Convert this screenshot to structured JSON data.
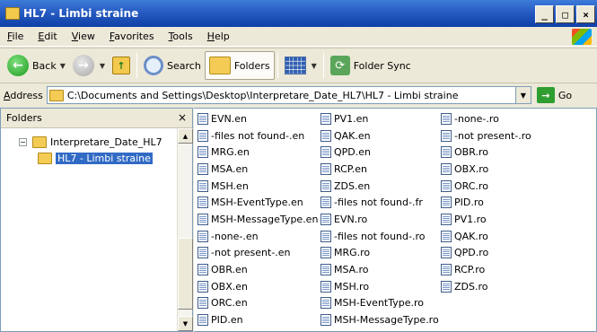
{
  "window": {
    "title": "HL7 - Limbi straine",
    "controls": [
      "_",
      "□",
      "×"
    ]
  },
  "menu": [
    "File",
    "Edit",
    "View",
    "Favorites",
    "Tools",
    "Help"
  ],
  "toolbar": {
    "back_label": "Back",
    "search_label": "Search",
    "folders_label": "Folders",
    "folder_sync_label": "Folder Sync"
  },
  "address": {
    "label": "Address",
    "value": "C:\\Documents and Settings\\Desktop\\Interpretare_Date_HL7\\HL7 - Limbi straine",
    "go_label": "Go"
  },
  "folders_pane": {
    "title": "Folders",
    "close": "×",
    "tree": [
      {
        "label": "Interpretare_Date_HL7",
        "expander": "−"
      },
      {
        "label": "HL7 - Limbi straine"
      }
    ]
  },
  "files": {
    "col1": [
      "EVN.en",
      "-files not found-.en",
      "MRG.en",
      "MSA.en",
      "MSH.en",
      "MSH-EventType.en",
      "MSH-MessageType.en",
      "-none-.en",
      "-not present-.en",
      "OBR.en",
      "OBX.en",
      "ORC.en",
      "PID.en"
    ],
    "col2": [
      "PV1.en",
      "QAK.en",
      "QPD.en",
      "RCP.en",
      "ZDS.en",
      "-files not found-.fr",
      "EVN.ro",
      "-files not found-.ro",
      "MRG.ro",
      "MSA.ro",
      "MSH.ro",
      "MSH-EventType.ro",
      "MSH-MessageType.ro"
    ],
    "col3": [
      "-none-.ro",
      "-not present-.ro",
      "OBR.ro",
      "OBX.ro",
      "ORC.ro",
      "PID.ro",
      "PV1.ro",
      "QAK.ro",
      "QPD.ro",
      "RCP.ro",
      "ZDS.ro"
    ]
  }
}
